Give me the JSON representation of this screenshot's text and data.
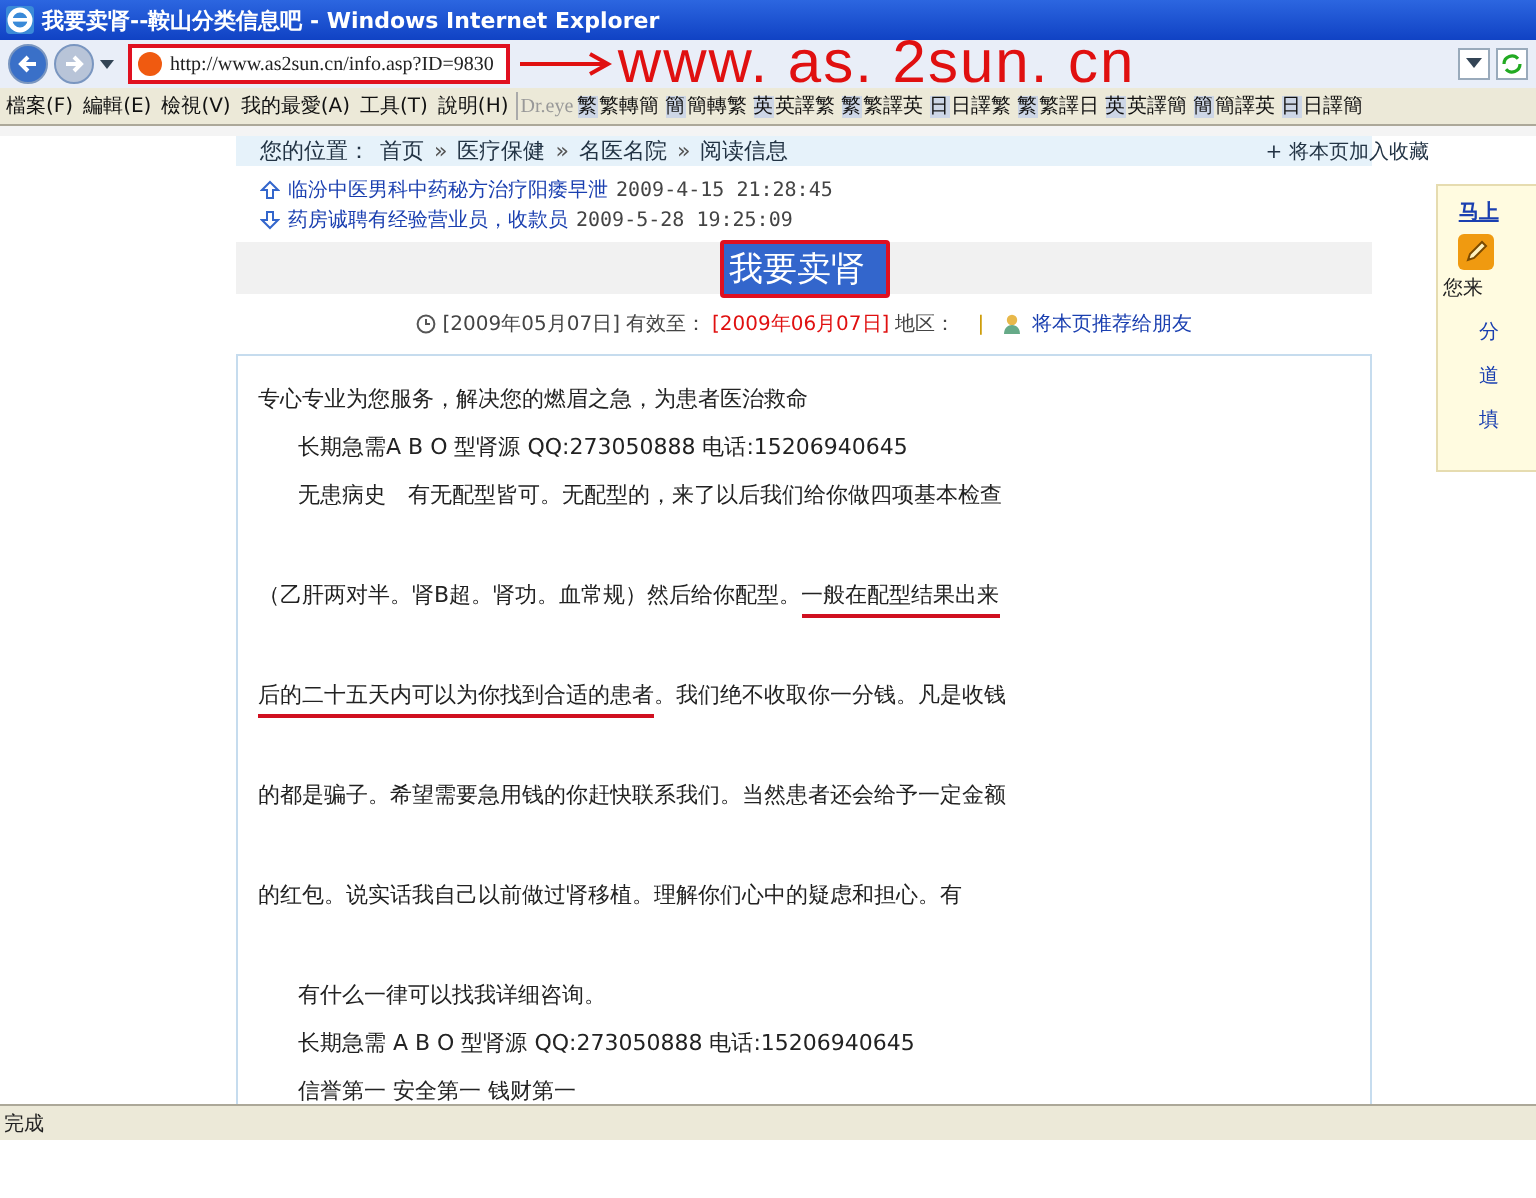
{
  "window": {
    "title": "我要卖肾--鞍山分类信息吧 - Windows Internet Explorer"
  },
  "address_bar": {
    "url": "http://www.as2sun.cn/info.asp?ID=9830"
  },
  "annotation": {
    "text": "www. as. 2sun. cn"
  },
  "menu": [
    "檔案(F)",
    "編輯(E)",
    "檢視(V)",
    "我的最愛(A)",
    "工具(T)",
    "說明(H)"
  ],
  "toolbar": {
    "brand": "Dr.eye",
    "buttons": [
      {
        "badge": "繁",
        "label": "繁轉簡"
      },
      {
        "badge": "簡",
        "label": "簡轉繁"
      },
      {
        "badge": "英",
        "label": "英譯繁"
      },
      {
        "badge": "繁",
        "label": "繁譯英"
      },
      {
        "badge": "日",
        "label": "日譯繁"
      },
      {
        "badge": "繁",
        "label": "繁譯日"
      },
      {
        "badge": "英",
        "label": "英譯簡"
      },
      {
        "badge": "簡",
        "label": "簡譯英"
      },
      {
        "badge": "日",
        "label": "日譯簡"
      }
    ]
  },
  "breadcrumb": {
    "label": "您的位置：",
    "items": [
      "首页",
      "医疗保健",
      "名医名院",
      "阅读信息"
    ],
    "separator": "»",
    "bookmark": "+ 将本页加入收藏"
  },
  "related": [
    {
      "kind": "up",
      "title": "临汾中医男科中药秘方治疗阳痿早泄",
      "time": "2009-4-15 21:28:45"
    },
    {
      "kind": "down",
      "title": "药房诚聘有经验营业员，收款员",
      "time": "2009-5-28 19:25:09"
    }
  ],
  "article": {
    "title": "我要卖肾",
    "posted": "[2009年05月07日]",
    "valid_label": "有效至：",
    "valid_until": "[2009年06月07日]",
    "region_label": "地区：",
    "divider": "|",
    "recommend": "将本页推荐给朋友",
    "lines": [
      {
        "kind": "lead",
        "segments": [
          {
            "text": "专心专业为您服务，解决您的燃眉之急，为患者医治救命",
            "underlined": false
          }
        ]
      },
      {
        "kind": "indent",
        "segments": [
          {
            "text": "长期急需A B O 型肾源 QQ:273050888 电话:15206940645",
            "underlined": false
          }
        ]
      },
      {
        "kind": "indent",
        "segments": [
          {
            "text": "无患病史　有无配型皆可。无配型的，来了以后我们给你做四项基本检查",
            "underlined": false
          }
        ]
      },
      {
        "kind": "para",
        "segments": [
          {
            "text": "（乙肝两对半。肾B超。肾功。血常规）然后给你配型。",
            "underlined": false
          },
          {
            "text": "一般在配型结果出来",
            "underlined": true
          }
        ]
      },
      {
        "kind": "para",
        "segments": [
          {
            "text": "后的二十五天内可以为你找到合适的患者",
            "underlined": true
          },
          {
            "text": "。我们绝不收取你一分钱。凡是收钱",
            "underlined": false
          }
        ]
      },
      {
        "kind": "para",
        "segments": [
          {
            "text": "的都是骗子。希望需要急用钱的你赶快联系我们。当然患者还会给予一定金额",
            "underlined": false
          }
        ]
      },
      {
        "kind": "para",
        "segments": [
          {
            "text": "的红包。说实话我自己以前做过肾移植。理解你们心中的疑虑和担心。有",
            "underlined": false
          }
        ]
      },
      {
        "kind": "para-indent",
        "segments": [
          {
            "text": "有什么一律可以找我详细咨询。",
            "underlined": false
          }
        ]
      },
      {
        "kind": "indent",
        "segments": [
          {
            "text": "长期急需 A B O 型肾源 QQ:273050888 电话:15206940645",
            "underlined": false
          }
        ]
      },
      {
        "kind": "indent",
        "segments": [
          {
            "text": "信誉第一 安全第一 钱财第一",
            "underlined": false
          }
        ]
      }
    ]
  },
  "side_panel": {
    "link": "马上",
    "caption": "您来",
    "items": [
      "分",
      "道",
      "填"
    ]
  },
  "status_bar": {
    "text": "完成"
  }
}
